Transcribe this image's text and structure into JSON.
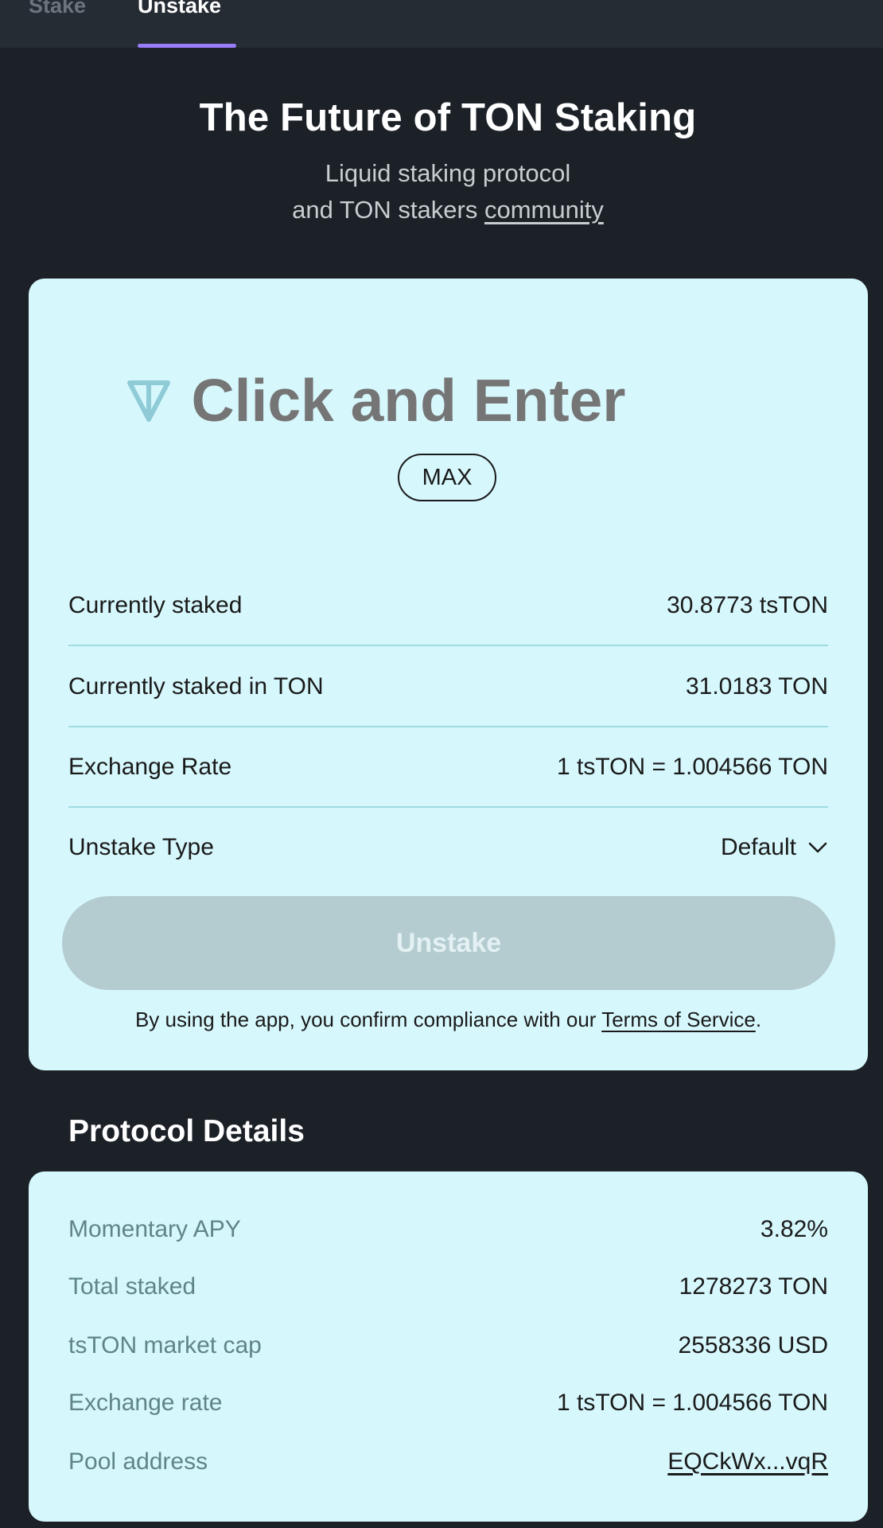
{
  "tabs": [
    {
      "label": "Stake",
      "active": false
    },
    {
      "label": "Unstake",
      "active": true
    }
  ],
  "hero": {
    "title": "The Future of TON Staking",
    "subtitle_line1": "Liquid staking protocol",
    "subtitle_line2_prefix": "and TON stakers ",
    "subtitle_link": "community"
  },
  "unstake_card": {
    "amount_placeholder": "Click and Enter",
    "max_label": "MAX",
    "rows": [
      {
        "label": "Currently staked",
        "value": "30.8773 tsTON"
      },
      {
        "label": "Currently staked in TON",
        "value": "31.0183 TON"
      },
      {
        "label": "Exchange Rate",
        "value": "1 tsTON = 1.004566 TON"
      },
      {
        "label": "Unstake Type",
        "value": "Default"
      }
    ],
    "unstake_button": "Unstake",
    "terms_prefix": "By using the app, you confirm compliance with our ",
    "terms_link": "Terms of Service",
    "terms_suffix": "."
  },
  "protocol_details": {
    "title": "Protocol Details",
    "rows": [
      {
        "label": "Momentary APY",
        "value": "3.82%"
      },
      {
        "label": "Total staked",
        "value": "1278273 TON"
      },
      {
        "label": "tsTON market cap",
        "value": "2558336 USD"
      },
      {
        "label": "Exchange rate",
        "value": "1 tsTON = 1.004566 TON"
      },
      {
        "label": "Pool address",
        "value": "EQCkWx...vqR"
      }
    ]
  },
  "colors": {
    "background": "#1c2128",
    "card": "#d6f7fc",
    "accent_tab": "#9a7dfb",
    "placeholder": "#8ecbd6",
    "button_disabled": "#b4ccd0"
  },
  "icons": [
    "ton-logo-icon",
    "chevron-down-icon"
  ]
}
